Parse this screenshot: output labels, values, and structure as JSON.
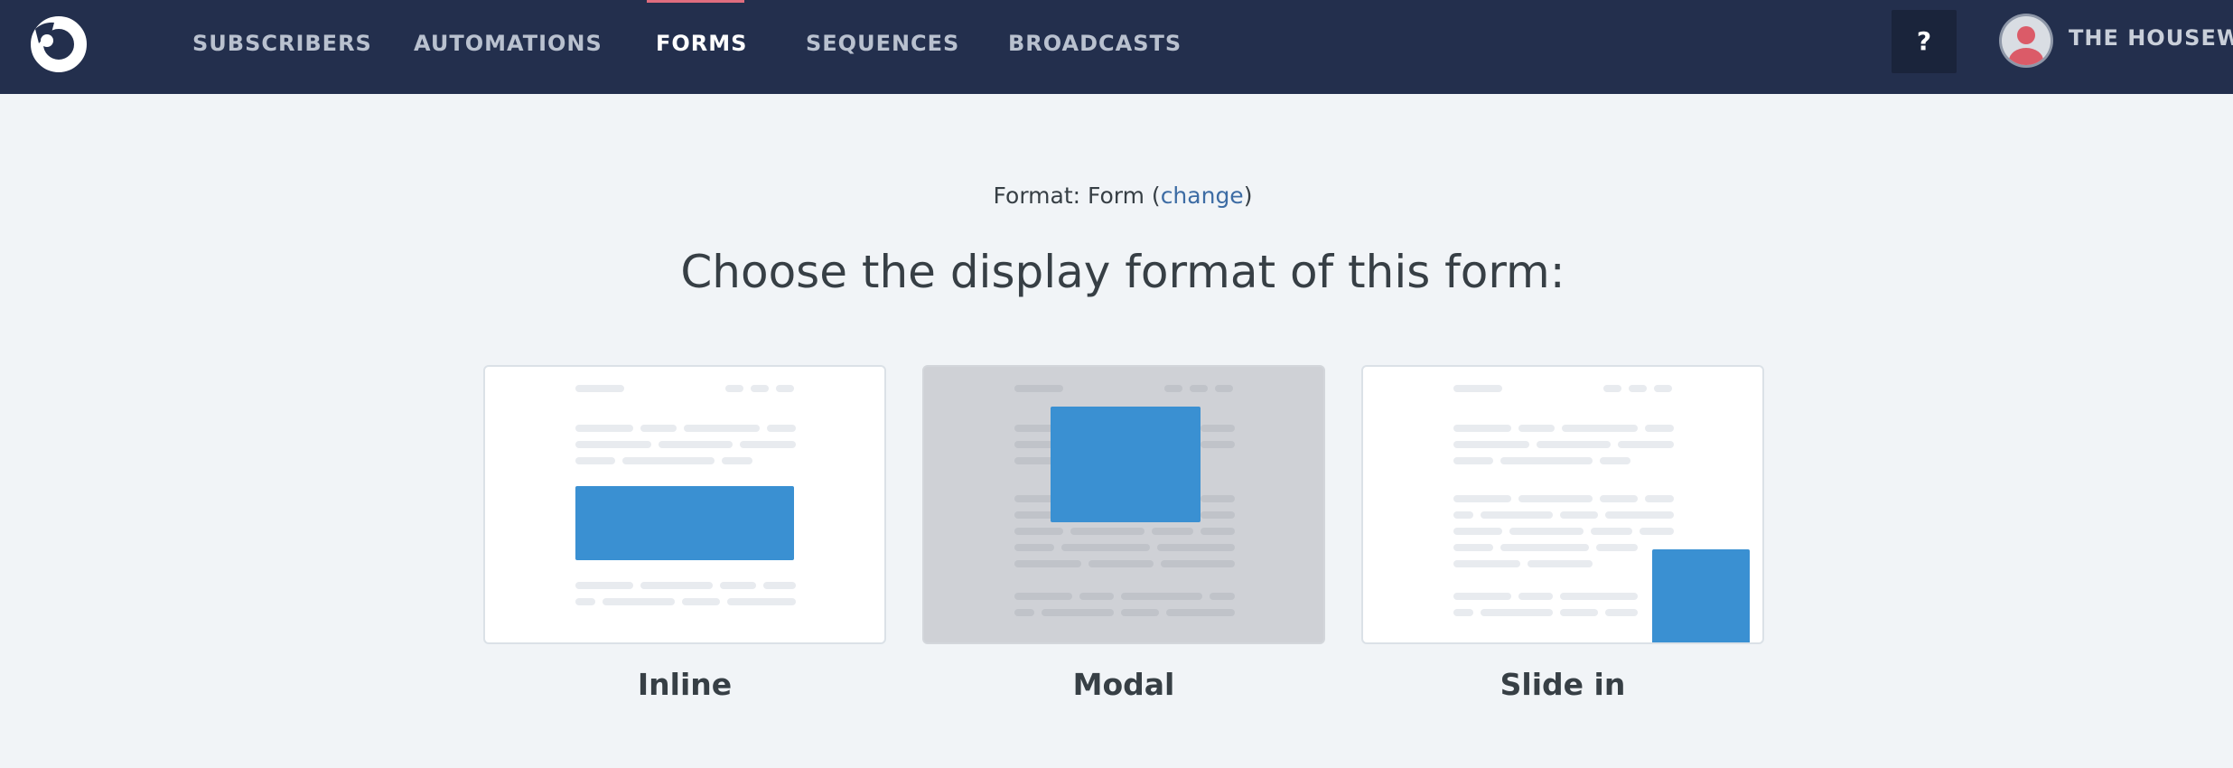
{
  "colors": {
    "topbar": "#232f4d",
    "accent_bar": "#e06d7e",
    "page_background": "#f1f4f7",
    "form_block": "#3a90d2",
    "link": "#3d6ca4"
  },
  "header": {
    "logo_icon": "convertkit-logo-icon",
    "nav": [
      {
        "label": "SUBSCRIBERS",
        "active": false
      },
      {
        "label": "AUTOMATIONS",
        "active": false
      },
      {
        "label": "FORMS",
        "active": true
      },
      {
        "label": "SEQUENCES",
        "active": false
      },
      {
        "label": "BROADCASTS",
        "active": false
      }
    ],
    "help_label": "?",
    "account_name": "THE HOUSEWIF",
    "avatar_icon": "user-avatar-icon"
  },
  "main": {
    "format_prefix": "Format: Form (",
    "format_link": "change",
    "format_suffix": ")",
    "title": "Choose the display format of this form:",
    "options": [
      {
        "label": "Inline",
        "icon": "inline-form-preview"
      },
      {
        "label": "Modal",
        "icon": "modal-form-preview"
      },
      {
        "label": "Slide in",
        "icon": "slide-in-form-preview"
      }
    ]
  }
}
